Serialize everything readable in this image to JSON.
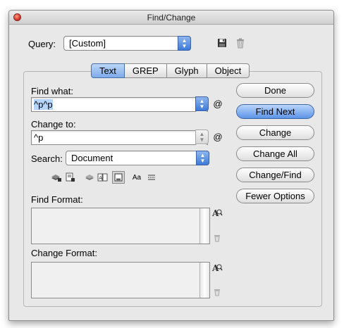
{
  "window": {
    "title": "Find/Change"
  },
  "query": {
    "label": "Query:",
    "value": "[Custom]"
  },
  "tabs": [
    {
      "label": "Text"
    },
    {
      "label": "GREP"
    },
    {
      "label": "Glyph"
    },
    {
      "label": "Object"
    }
  ],
  "find_what": {
    "label": "Find what:",
    "value": "^p^p"
  },
  "change_to": {
    "label": "Change to:",
    "value": "^p"
  },
  "search": {
    "label": "Search:",
    "value": "Document"
  },
  "options_row": {
    "case_label": "Aa"
  },
  "find_format": {
    "label": "Find Format:"
  },
  "change_format": {
    "label": "Change Format:"
  },
  "buttons": {
    "done": "Done",
    "find_next": "Find Next",
    "change": "Change",
    "change_all": "Change All",
    "change_find": "Change/Find",
    "fewer_options": "Fewer Options"
  },
  "colors": {
    "accent_blue": "#5d93e6",
    "window_bg": "#e8e8e8",
    "close_red": "#d6382a"
  }
}
